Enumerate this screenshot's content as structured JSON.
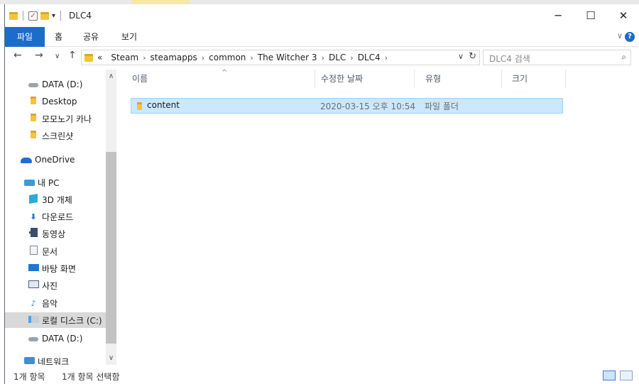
{
  "window": {
    "title": "DLC4",
    "controls": {
      "minimize": "─",
      "maximize": "☐",
      "close": "✕"
    }
  },
  "ribbon": {
    "tabs": [
      "파일",
      "홈",
      "공유",
      "보기"
    ],
    "expand_glyph": "∨",
    "help_glyph": "?"
  },
  "address": {
    "overflow": "«",
    "crumbs": [
      "Steam",
      "steamapps",
      "common",
      "The Witcher 3",
      "DLC",
      "DLC4"
    ],
    "separator": "›"
  },
  "search": {
    "placeholder": "DLC4 검색"
  },
  "nav_pane": {
    "items": [
      {
        "label": "DATA (D:)",
        "icon": "drive-icon"
      },
      {
        "label": "Desktop",
        "icon": "folder-icon"
      },
      {
        "label": "모모노기 카나",
        "icon": "folder-icon"
      },
      {
        "label": "스크린샷",
        "icon": "folder-icon"
      },
      {
        "label": "OneDrive",
        "icon": "onedrive-icon"
      },
      {
        "label": "내 PC",
        "icon": "pc-icon"
      },
      {
        "label": "3D 개체",
        "icon": "cube-icon"
      },
      {
        "label": "다운로드",
        "icon": "download-icon"
      },
      {
        "label": "동영상",
        "icon": "video-icon"
      },
      {
        "label": "문서",
        "icon": "document-icon"
      },
      {
        "label": "바탕 화면",
        "icon": "desktop-icon"
      },
      {
        "label": "사진",
        "icon": "picture-icon"
      },
      {
        "label": "음악",
        "icon": "music-icon"
      },
      {
        "label": "로컬 디스크 (C:)",
        "icon": "windows-drive-icon",
        "selected": true
      },
      {
        "label": "DATA (D:)",
        "icon": "drive-icon"
      },
      {
        "label": "네트워크",
        "icon": "network-icon"
      }
    ]
  },
  "columns": [
    "이름",
    "수정한 날짜",
    "유형",
    "크기"
  ],
  "files": [
    {
      "name": "content",
      "modified": "2020-03-15 오후 10:54",
      "type": "파일 폴더",
      "size": ""
    }
  ],
  "status": {
    "item_count": "1개 항목",
    "selection": "1개 항목 선택함"
  },
  "colors": {
    "accent": "#1a6dcc",
    "selection": "#cce8ff",
    "selection_border": "#99d1ff",
    "folder": "#f3c43e"
  }
}
